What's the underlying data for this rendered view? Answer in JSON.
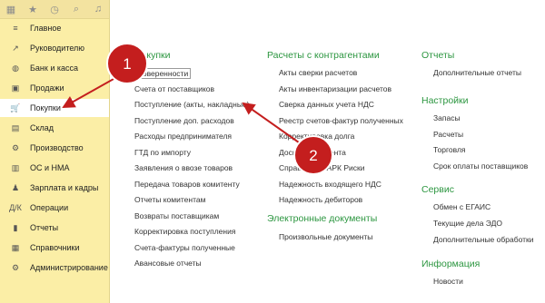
{
  "toolbar": {
    "icons": [
      "grid-icon",
      "star-icon",
      "history-icon",
      "search-icon",
      "bell-icon"
    ]
  },
  "sidebar": {
    "items": [
      {
        "label": "Главное",
        "icon": "menu-icon",
        "glyph": "≡"
      },
      {
        "label": "Руководителю",
        "icon": "chart-icon",
        "glyph": "↗"
      },
      {
        "label": "Банк и касса",
        "icon": "coin-icon",
        "glyph": "◍"
      },
      {
        "label": "Продажи",
        "icon": "cart-sell-icon",
        "glyph": "▣"
      },
      {
        "label": "Покупки",
        "icon": "cart-icon",
        "glyph": "🛒"
      },
      {
        "label": "Склад",
        "icon": "warehouse-icon",
        "glyph": "▤"
      },
      {
        "label": "Производство",
        "icon": "factory-icon",
        "glyph": "⚙"
      },
      {
        "label": "ОС и НМА",
        "icon": "assets-icon",
        "glyph": "▥"
      },
      {
        "label": "Зарплата и кадры",
        "icon": "people-icon",
        "glyph": "♟"
      },
      {
        "label": "Операции",
        "icon": "operations-icon",
        "glyph": "Д/К"
      },
      {
        "label": "Отчеты",
        "icon": "reports-icon",
        "glyph": "▮"
      },
      {
        "label": "Справочники",
        "icon": "books-icon",
        "glyph": "▦"
      },
      {
        "label": "Администрирование",
        "icon": "admin-icon",
        "glyph": "⚙"
      }
    ],
    "active_index": 4
  },
  "columns": {
    "purchases": {
      "heading": "Покупки",
      "links": [
        "Доверенности",
        "Счета от поставщиков",
        "Поступление (акты, накладные)",
        "Поступление доп. расходов",
        "Расходы предпринимателя",
        "ГТД по импорту",
        "Заявления о ввозе товаров",
        "Передача товаров комитенту",
        "Отчеты комитентам",
        "Возвраты поставщикам",
        "Корректировка поступления",
        "Счета-фактуры полученные",
        "Авансовые отчеты"
      ]
    },
    "settlements": {
      "heading": "Расчеты с контрагентами",
      "links": [
        "Акты сверки расчетов",
        "Акты инвентаризации расчетов",
        "Сверка данных учета НДС",
        "Реестр счетов-фактур полученных",
        "Корректировка долга",
        "Досье контрагента",
        "Справка 1СПАРК Риски",
        "Надежность входящего НДС",
        "Надежность дебиторов"
      ]
    },
    "edocs": {
      "heading": "Электронные документы",
      "links": [
        "Произвольные документы"
      ]
    },
    "reports": {
      "heading": "Отчеты",
      "links": [
        "Дополнительные отчеты"
      ]
    },
    "settings": {
      "heading": "Настройки",
      "links": [
        "Запасы",
        "Расчеты",
        "Торговля",
        "Срок оплаты поставщиков"
      ]
    },
    "service": {
      "heading": "Сервис",
      "links": [
        "Обмен с ЕГАИС",
        "Текущие дела ЭДО",
        "Дополнительные обработки"
      ]
    },
    "info": {
      "heading": "Информация",
      "links": [
        "Новости"
      ]
    }
  },
  "annotations": {
    "badge1": "1",
    "badge2": "2",
    "color": "#c41e1e"
  }
}
